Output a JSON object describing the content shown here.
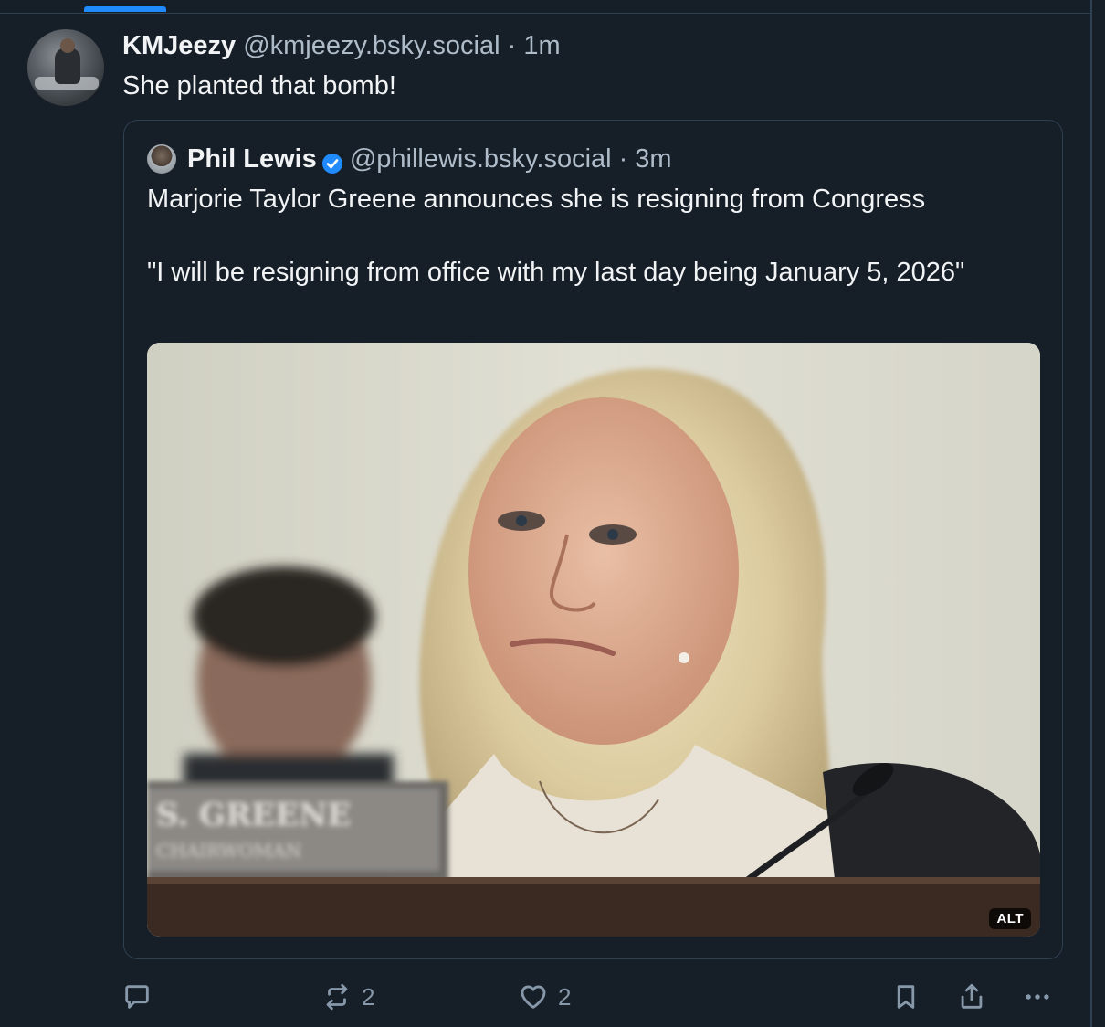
{
  "post": {
    "author_name": "KMJeezy",
    "author_handle": "@kmjeezy.bsky.social",
    "separator": "·",
    "time": "1m",
    "text": "She planted that bomb!"
  },
  "quote": {
    "author_name": "Phil Lewis",
    "author_handle": "@phillewis.bsky.social",
    "separator": "·",
    "time": "3m",
    "text_line1": "Marjorie Taylor Greene announces she is resigning from Congress",
    "text_line2": "\"I will be resigning from office with my last day being January 5, 2026\"",
    "image_alt_badge": "ALT",
    "nameplate_text": "S. GREENE\nCHAIRWOMAN"
  },
  "actions": {
    "reply_icon": "reply-icon",
    "repost_icon": "repost-icon",
    "repost_count": "2",
    "like_icon": "heart-icon",
    "like_count": "2",
    "bookmark_icon": "bookmark-icon",
    "share_icon": "share-icon",
    "more_icon": "more-icon"
  },
  "colors": {
    "background": "#161e27",
    "border": "#2e4052",
    "accent": "#208bfe",
    "muted_text": "#aebbc9",
    "icon": "#8798aa"
  }
}
